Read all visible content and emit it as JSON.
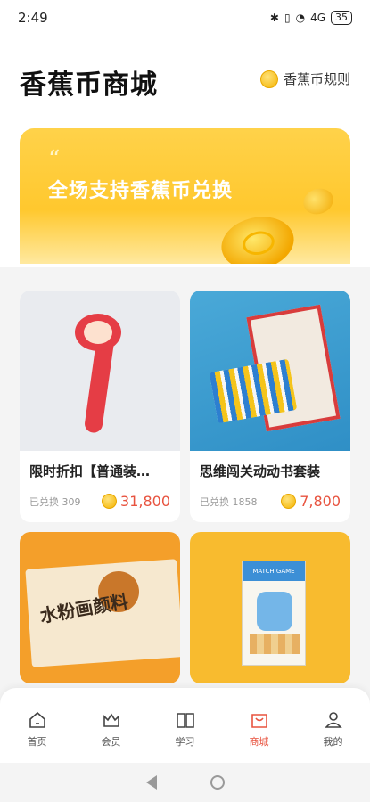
{
  "status_bar": {
    "time": "2:49",
    "battery": "35",
    "network": "4G"
  },
  "header": {
    "title": "香蕉币商城",
    "rules_label": "香蕉币规则"
  },
  "banner": {
    "quote": "“",
    "text": "全场支持香蕉币兑换"
  },
  "products": [
    {
      "title": "限时折扣【普通装…",
      "redeemed": "已兑换 309",
      "price": "31,800"
    },
    {
      "title": "思维闯关动动书套装",
      "redeemed": "已兑换 1858",
      "price": "7,800"
    },
    {
      "box_text": "水粉画颜料"
    },
    {
      "box_top": "MATCH GAME"
    }
  ],
  "nav": [
    {
      "label": "首页",
      "icon": "home-icon"
    },
    {
      "label": "会员",
      "icon": "crown-icon"
    },
    {
      "label": "学习",
      "icon": "book-icon"
    },
    {
      "label": "商城",
      "icon": "shopping-bag-icon",
      "active": true
    },
    {
      "label": "我的",
      "icon": "user-icon"
    }
  ],
  "colors": {
    "accent": "#e8533f",
    "coin": "#f4b400",
    "banner": "#ffc82e"
  }
}
